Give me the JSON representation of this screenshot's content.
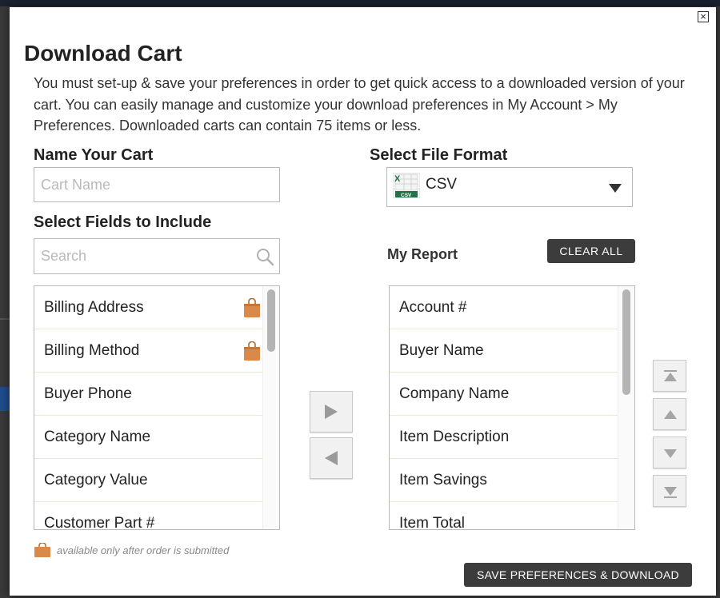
{
  "dialog": {
    "title": "Download Cart",
    "intro": "You must set-up & save your preferences in order to get quick access to a downloaded version of your cart. You can easily manage and customize your download preferences in My Account > My Preferences. Downloaded carts can contain 75 items or less.",
    "close_glyph": "×"
  },
  "name_section": {
    "label": "Name Your Cart",
    "placeholder": "Cart Name",
    "value": ""
  },
  "format_section": {
    "label": "Select File Format",
    "selected": "CSV",
    "icon": "excel-csv-icon",
    "icon_badge": "CSV"
  },
  "fields_section": {
    "label": "Select Fields to Include",
    "search_placeholder": "Search",
    "available_fields": [
      {
        "label": "Billing Address",
        "order_only": true
      },
      {
        "label": "Billing Method",
        "order_only": true
      },
      {
        "label": "Buyer Phone",
        "order_only": false
      },
      {
        "label": "Category Name",
        "order_only": false
      },
      {
        "label": "Category Value",
        "order_only": false
      },
      {
        "label": "Customer Part #",
        "order_only": false
      }
    ]
  },
  "report_section": {
    "label": "My Report",
    "clear_all_label": "CLEAR ALL",
    "selected_fields": [
      "Account #",
      "Buyer Name",
      "Company Name",
      "Item Description",
      "Item Savings",
      "Item Total"
    ]
  },
  "footnote": "available only after order is submitted",
  "save_label": "SAVE PREFERENCES & DOWNLOAD",
  "colors": {
    "button_dark": "#3c3c3c",
    "bag_orange": "#d9894a",
    "excel_green": "#217346",
    "row_divider": "#e7efc9"
  }
}
